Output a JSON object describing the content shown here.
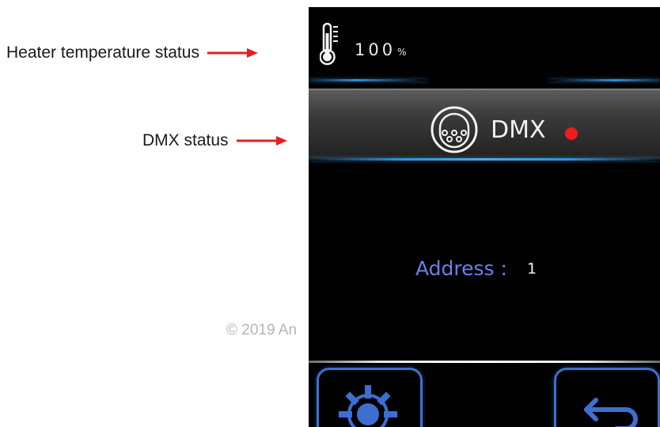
{
  "annotations": {
    "heater": "Heater temperature status",
    "dmx": "DMX status"
  },
  "copyright": "© 2019 An",
  "status": {
    "temperature_value": "100",
    "temperature_unit": "%",
    "icon": "thermometer-icon"
  },
  "dmx": {
    "label": "DMX",
    "icon": "dmx-connector-icon",
    "status_color": "#ee1c1c"
  },
  "address": {
    "label": "Address :",
    "value": "1"
  },
  "buttons": {
    "settings_icon": "gear-icon",
    "back_icon": "back-arrow-icon"
  },
  "colors": {
    "accent_blue": "#3d6fd1",
    "annotation_arrow": "#e81e1e",
    "address_label": "#6f7fe8"
  }
}
